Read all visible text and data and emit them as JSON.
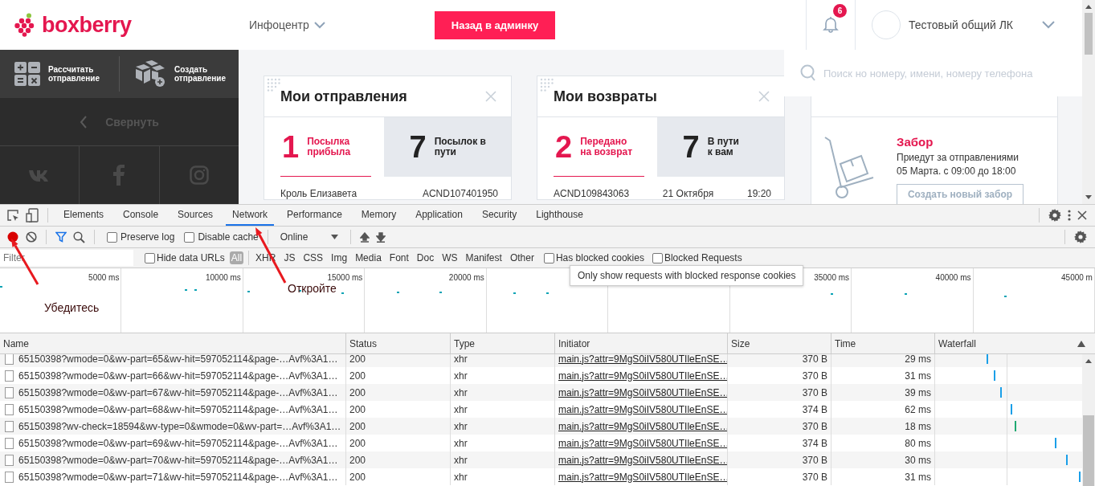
{
  "header": {
    "logo": "boxberry",
    "menu": "Инфоцентр",
    "admin_button": "Назад в админку",
    "notifications_badge": "6",
    "account": "Тестовый общий ЛК"
  },
  "sidebar": {
    "actions": [
      {
        "kind": "calculator",
        "label": "Рассчитать\nотправление"
      },
      {
        "kind": "create",
        "label": "Создать\nотправление"
      }
    ],
    "collapse": "Свернуть",
    "social": [
      {
        "kind": "vk"
      },
      {
        "kind": "facebook"
      },
      {
        "kind": "instagram"
      }
    ]
  },
  "cards": [
    {
      "title": "Мои отправления",
      "primary": {
        "count": "1",
        "label": "Посылка\nприбыла"
      },
      "secondary": {
        "count": "7",
        "label": "Посылок в\nпути"
      },
      "row": [
        "Кроль Елизавета",
        "ACND107401950"
      ]
    },
    {
      "title": "Мои возвраты",
      "primary": {
        "count": "2",
        "label": "Передано\nна возврат"
      },
      "secondary": {
        "count": "7",
        "label": "В пути\nк вам"
      },
      "row": [
        "ACND109843063",
        "21 Октября",
        "19:20"
      ]
    }
  ],
  "search": {
    "placeholder": "Поиск но номеру, имени, номеру телефона"
  },
  "pickup": {
    "title": "Забор",
    "lines": [
      "Приедут за отправлениями",
      "05 Марта. с 09:00 до 18:00"
    ],
    "button": "Создать новый забор"
  },
  "devtools": {
    "tabs": [
      {
        "label": "Elements",
        "selected": false
      },
      {
        "label": "Console",
        "selected": false
      },
      {
        "label": "Sources",
        "selected": false
      },
      {
        "label": "Network",
        "selected": true
      },
      {
        "label": "Performance",
        "selected": false
      },
      {
        "label": "Memory",
        "selected": false
      },
      {
        "label": "Application",
        "selected": false
      },
      {
        "label": "Security",
        "selected": false
      },
      {
        "label": "Lighthouse",
        "selected": false
      }
    ],
    "recording": true,
    "filter_active": true,
    "options": [
      {
        "label": "Preserve log",
        "checked": false
      },
      {
        "label": "Disable cache",
        "checked": false
      }
    ],
    "throttling": "Online",
    "filter_placeholder": "Filter",
    "hide_data_urls": {
      "label": "Hide data URLs",
      "checked": false
    },
    "types": [
      {
        "label": "All",
        "selected": true
      },
      {
        "label": "XHR",
        "selected": false
      },
      {
        "label": "JS",
        "selected": false
      },
      {
        "label": "CSS",
        "selected": false
      },
      {
        "label": "Img",
        "selected": false
      },
      {
        "label": "Media",
        "selected": false
      },
      {
        "label": "Font",
        "selected": false
      },
      {
        "label": "Doc",
        "selected": false
      },
      {
        "label": "WS",
        "selected": false
      },
      {
        "label": "Manifest",
        "selected": false
      },
      {
        "label": "Other",
        "selected": false
      }
    ],
    "extra_filters": [
      {
        "label": "Has blocked cookies",
        "checked": false
      },
      {
        "label": "Blocked Requests",
        "checked": false
      }
    ],
    "tooltip": "Only show requests with blocked response cookies",
    "overview_ticks": [
      "5000 ms",
      "10000 ms",
      "15000 ms",
      "20000 ms",
      "35000 ms",
      "40000 ms",
      "45000 m"
    ]
  },
  "table": {
    "columns": [
      "Name",
      "Status",
      "Type",
      "Initiator",
      "Size",
      "Time",
      "Waterfall"
    ],
    "rows": [
      {
        "name": "65150398?wmode=0&wv-part=65&wv-hit=597052114&page-…Avf%3A1…",
        "status": "200",
        "type": "xhr",
        "initiator": "main.js?attr=9MgS0iIV580UTIleEnSE…",
        "size": "370 B",
        "time": "29 ms"
      },
      {
        "name": "65150398?wmode=0&wv-part=66&wv-hit=597052114&page-…Avf%3A1…",
        "status": "200",
        "type": "xhr",
        "initiator": "main.js?attr=9MgS0iIV580UTIleEnSE…",
        "size": "370 B",
        "time": "31 ms"
      },
      {
        "name": "65150398?wmode=0&wv-part=67&wv-hit=597052114&page-…Avf%3A1…",
        "status": "200",
        "type": "xhr",
        "initiator": "main.js?attr=9MgS0iIV580UTIleEnSE…",
        "size": "370 B",
        "time": "39 ms"
      },
      {
        "name": "65150398?wmode=0&wv-part=68&wv-hit=597052114&page-…Avf%3A1…",
        "status": "200",
        "type": "xhr",
        "initiator": "main.js?attr=9MgS0iIV580UTIleEnSE…",
        "size": "374 B",
        "time": "62 ms"
      },
      {
        "name": "65150398?wv-check=18594&wv-type=0&wmode=0&wv-part=…Avf%3A1…",
        "status": "200",
        "type": "xhr",
        "initiator": "main.js?attr=9MgS0iIV580UTIleEnSE…",
        "size": "370 B",
        "time": "18 ms"
      },
      {
        "name": "65150398?wmode=0&wv-part=69&wv-hit=597052114&page-…Avf%3A1…",
        "status": "200",
        "type": "xhr",
        "initiator": "main.js?attr=9MgS0iIV580UTIleEnSE…",
        "size": "374 B",
        "time": "80 ms"
      },
      {
        "name": "65150398?wmode=0&wv-part=70&wv-hit=597052114&page-…Avf%3A1…",
        "status": "200",
        "type": "xhr",
        "initiator": "main.js?attr=9MgS0iIV580UTIleEnSE…",
        "size": "370 B",
        "time": "30 ms"
      },
      {
        "name": "65150398?wmode=0&wv-part=71&wv-hit=597052114&page-…Avf%3A1…",
        "status": "200",
        "type": "xhr",
        "initiator": "main.js?attr=9MgS0iIV580UTIleEnSE…",
        "size": "370 B",
        "time": "31 ms"
      }
    ]
  },
  "annotations": [
    {
      "text": "Убедитесь"
    },
    {
      "text": "Откройте"
    }
  ]
}
